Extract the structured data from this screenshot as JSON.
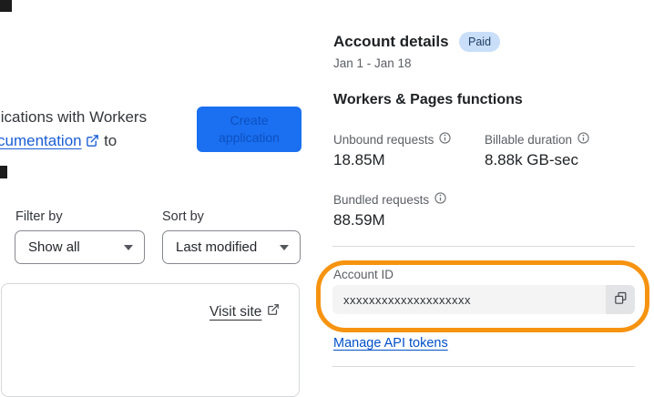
{
  "left_panel": {
    "intro_line1": "lications with Workers",
    "intro_link_text": "cumentation",
    "intro_line2_suffix": " to",
    "create_button_label": "Create application",
    "filter_label": "Filter by",
    "filter_value": "Show all",
    "sort_label": "Sort by",
    "sort_value": "Last modified",
    "visit_site_label": "Visit site"
  },
  "account_details": {
    "title": "Account details",
    "plan_badge": "Paid",
    "date_range": "Jan 1 - Jan 18",
    "section_title": "Workers & Pages functions",
    "stats": {
      "0": {
        "label": "Unbound requests",
        "value": "18.85M"
      },
      "1": {
        "label": "Billable duration",
        "value": "8.88k GB-sec"
      },
      "2": {
        "label": "Bundled requests",
        "value": "88.59M"
      }
    },
    "account_id": {
      "label": "Account ID",
      "value": "xxxxxxxxxxxxxxxxxxxx"
    },
    "manage_api_tokens_label": "Manage API tokens"
  },
  "colors": {
    "primary_button_bg": "#1a70f0",
    "primary_button_text": "#0e4fc2",
    "link_blue": "#0050c9",
    "badge_bg": "#c9def9",
    "badge_text": "#1e3e63",
    "highlight_orange": "#f69310",
    "input_bg": "#f4f4f5",
    "copy_button_bg": "#e3e4e6"
  }
}
